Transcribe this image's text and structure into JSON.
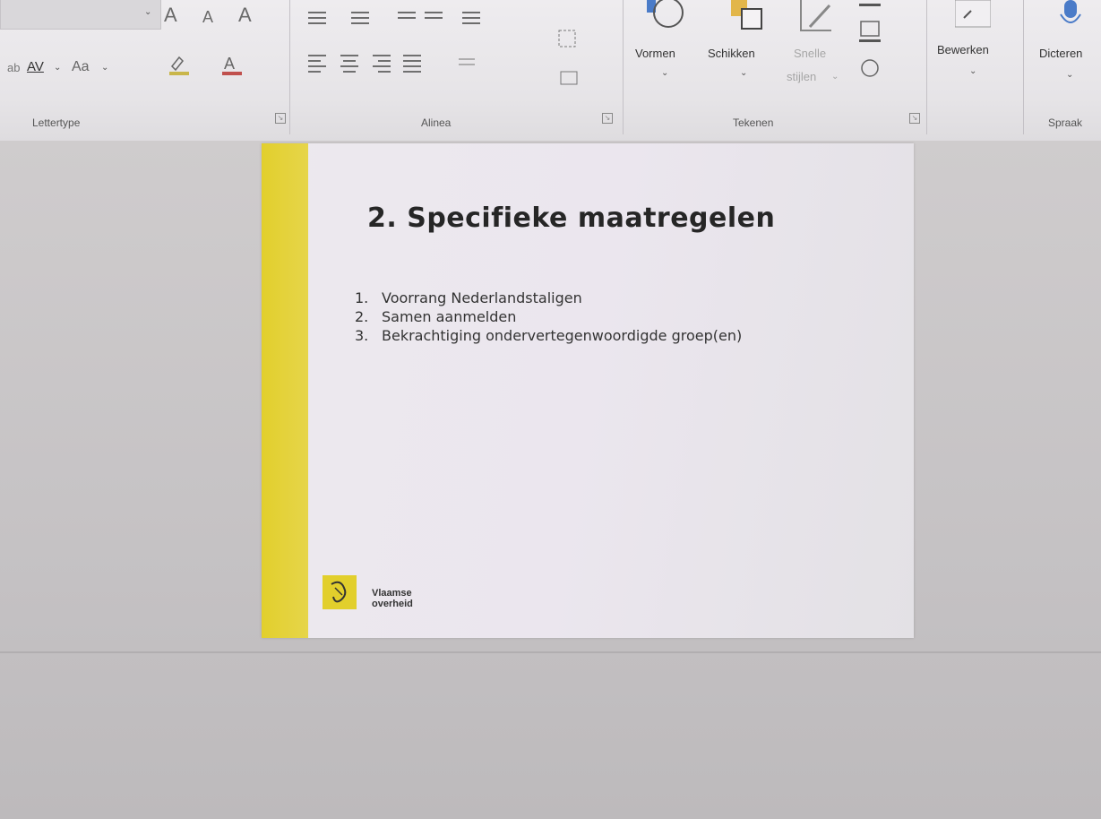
{
  "ribbon": {
    "groups": {
      "lettertype": "Lettertype",
      "alinea": "Alinea",
      "tekenen": "Tekenen",
      "spraak": "Spraak"
    },
    "lettertype": {
      "grow_font": "A",
      "shrink_font": "A",
      "clear_format": "A",
      "char_spacing": "AV",
      "change_case": "Aa"
    },
    "tekenen": {
      "vormen": "Vormen",
      "schikken": "Schikken",
      "snelle": "Snelle",
      "stijlen": "stijlen"
    },
    "bewerken": "Bewerken",
    "dicteren": "Dicteren"
  },
  "slide": {
    "title": "2. Specifieke maatregelen",
    "items": [
      {
        "num": "1.",
        "text": "Voorrang Nederlandstaligen"
      },
      {
        "num": "2.",
        "text": "Samen aanmelden"
      },
      {
        "num": "3.",
        "text": "Bekrachtiging ondervertegenwoordigde groep(en)"
      }
    ],
    "logo_line1": "Vlaamse",
    "logo_line2": "overheid",
    "accent_color": "#e2cf2c"
  }
}
